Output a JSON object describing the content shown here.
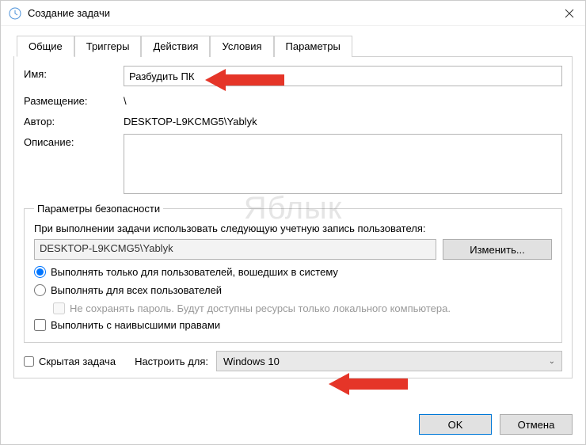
{
  "window": {
    "title": "Создание задачи"
  },
  "tabs": {
    "general": "Общие",
    "triggers": "Триггеры",
    "actions": "Действия",
    "conditions": "Условия",
    "settings": "Параметры"
  },
  "labels": {
    "name": "Имя:",
    "location": "Размещение:",
    "author": "Автор:",
    "description": "Описание:"
  },
  "values": {
    "name": "Разбудить ПК",
    "location": "\\",
    "author": "DESKTOP-L9KCMG5\\Yablyk",
    "description": ""
  },
  "security": {
    "legend": "Параметры безопасности",
    "use_account_text": "При выполнении задачи использовать следующую учетную запись пользователя:",
    "account": "DESKTOP-L9KCMG5\\Yablyk",
    "change_btn": "Изменить...",
    "radio_logged_on": "Выполнять только для пользователей, вошедших в систему",
    "radio_all_users": "Выполнять для всех пользователей",
    "no_password": "Не сохранять пароль. Будут доступны ресурсы только локального компьютера.",
    "highest_priv": "Выполнить с наивысшими правами"
  },
  "bottom": {
    "hidden_task": "Скрытая задача",
    "configure_for": "Настроить для:",
    "os_value": "Windows 10"
  },
  "footer": {
    "ok": "OK",
    "cancel": "Отмена"
  },
  "watermark": "Яблык"
}
